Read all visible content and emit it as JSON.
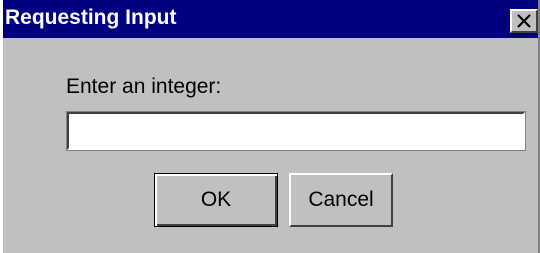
{
  "window": {
    "title": "Requesting Input",
    "close_icon": "close-icon"
  },
  "form": {
    "prompt_label": "Enter an integer:",
    "input_value": "",
    "input_placeholder": ""
  },
  "buttons": {
    "ok_label": "OK",
    "cancel_label": "Cancel"
  },
  "colors": {
    "titlebar": "#000080",
    "dialog_bg": "#c0c0c0",
    "title_text": "#ffffff"
  }
}
